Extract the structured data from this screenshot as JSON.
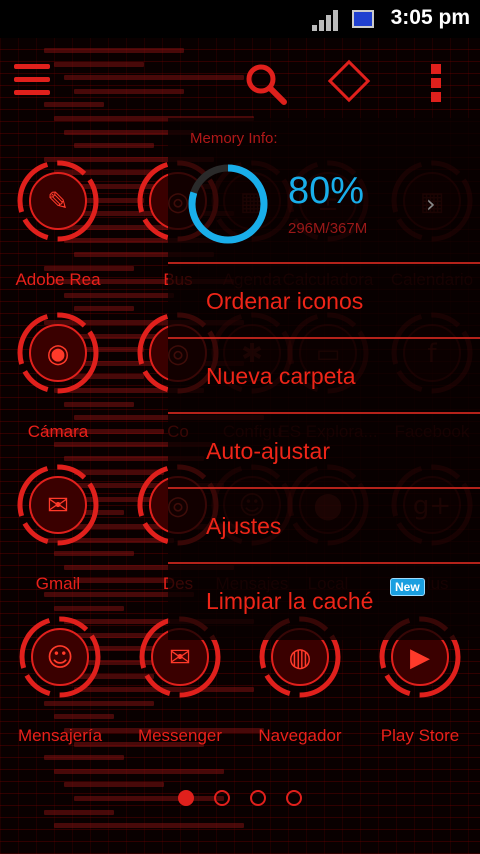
{
  "status_bar": {
    "time": "3:05 pm",
    "icons": [
      "signal-icon",
      "battery-icon"
    ]
  },
  "top_bar": {
    "icons": [
      "menu-icon",
      "search-icon",
      "android-icon",
      "more-icon"
    ]
  },
  "apps": [
    {
      "label": "Adobe Rea",
      "icon": "acrobat-icon",
      "dim": false
    },
    {
      "label": "Bus",
      "icon": "ring-icon",
      "dim": false
    },
    {
      "label": "Agenda",
      "icon": "calendar-icon",
      "dim": true
    },
    {
      "label": "Calculadora",
      "icon": "calculator-icon",
      "dim": true
    },
    {
      "label": "Calendario",
      "icon": "calendar-icon",
      "dim": true
    },
    {
      "label": "Cámara",
      "icon": "camera-icon",
      "dim": false
    },
    {
      "label": "Co",
      "icon": "ring-icon",
      "dim": false
    },
    {
      "label": "Configu",
      "icon": "gear-icon",
      "dim": true
    },
    {
      "label": "ES Explora...",
      "icon": "folder-icon",
      "dim": true
    },
    {
      "label": "Facebook",
      "icon": "facebook-icon",
      "dim": true
    },
    {
      "label": "Gmail",
      "icon": "gmail-icon",
      "dim": false
    },
    {
      "label": "Des",
      "icon": "ring-icon",
      "dim": false
    },
    {
      "label": "Mensajes",
      "icon": "chat-icon",
      "dim": true
    },
    {
      "label": "Local",
      "icon": "map-pin-icon",
      "dim": true
    },
    {
      "label": "Plus",
      "icon": "google-plus-icon",
      "dim": true
    },
    {
      "label": "Mensajería",
      "icon": "chat-icon",
      "dim": false
    },
    {
      "label": "Messenger",
      "icon": "messenger-icon",
      "dim": false
    },
    {
      "label": "Navegador",
      "icon": "browser-icon",
      "dim": false
    },
    {
      "label": "Play Store",
      "icon": "play-store-icon",
      "dim": false
    }
  ],
  "overlay": {
    "memory_title": "Memory Info:",
    "memory_percent": "80%",
    "memory_fraction": 0.8,
    "memory_usage": "296M/367M",
    "accent_color": "#19aeea",
    "items": [
      {
        "label": "Ordenar iconos"
      },
      {
        "label": "Nueva carpeta"
      },
      {
        "label": "Auto-ajustar"
      },
      {
        "label": "Ajustes"
      },
      {
        "label": "Limpiar la caché",
        "badge": "New"
      }
    ]
  },
  "pages": {
    "count": 4,
    "active": 0
  },
  "theme": {
    "accent": "#e0201c",
    "background": "#090000"
  }
}
